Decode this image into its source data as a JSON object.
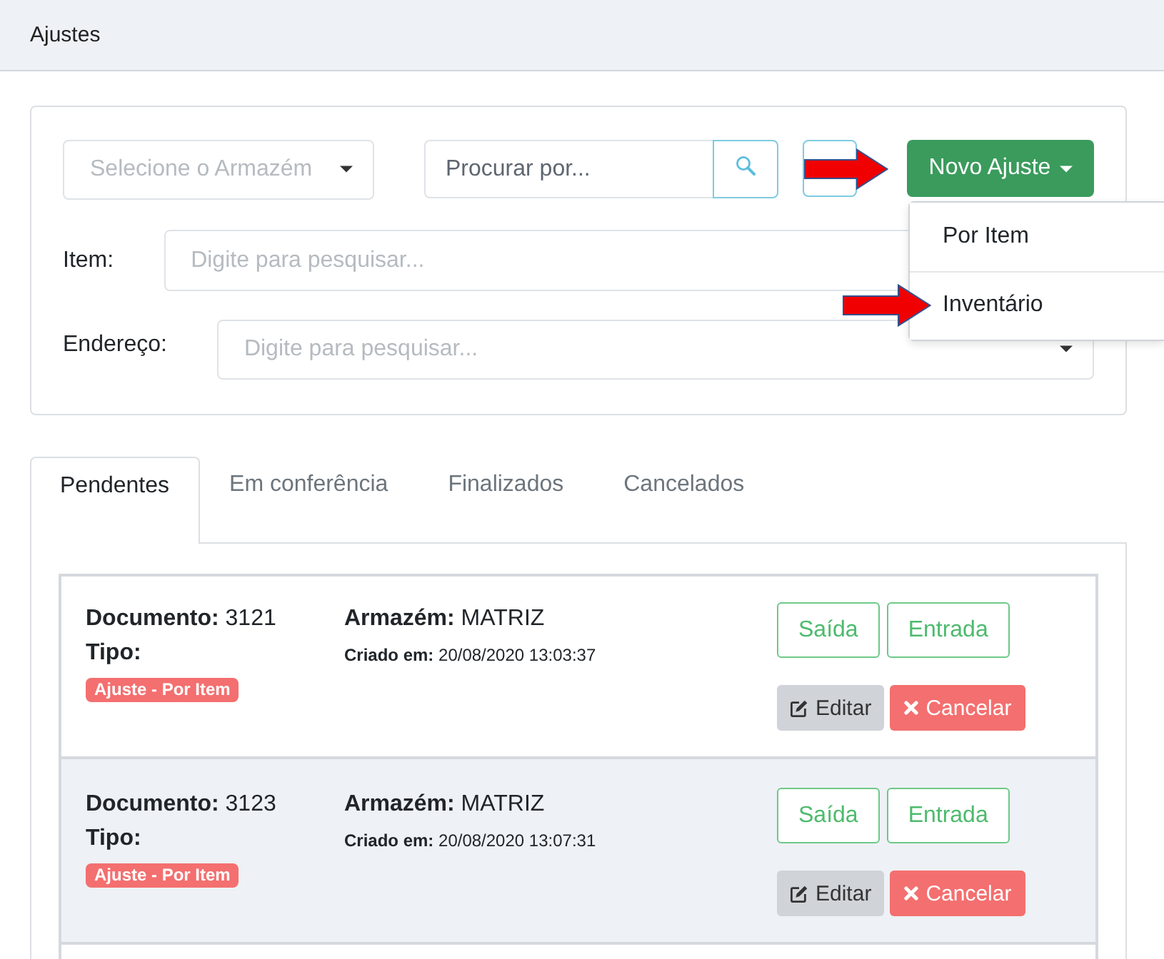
{
  "header": {
    "title": "Ajustes"
  },
  "filters": {
    "warehouse": {
      "placeholder": "Selecione o Armazém"
    },
    "search": {
      "placeholder": "Procurar por..."
    },
    "new_adjustment": {
      "label": "Novo Ajuste",
      "expanded": true,
      "menu": [
        {
          "label": "Por Item"
        },
        {
          "label": "Inventário"
        }
      ]
    },
    "item": {
      "label": "Item:",
      "placeholder": "Digite para pesquisar..."
    },
    "address": {
      "label": "Endereço:",
      "placeholder": "Digite para pesquisar..."
    }
  },
  "tabs": [
    {
      "label": "Pendentes",
      "selected": true
    },
    {
      "label": "Em conferência",
      "selected": false
    },
    {
      "label": "Finalizados",
      "selected": false
    },
    {
      "label": "Cancelados",
      "selected": false
    }
  ],
  "documents": [
    {
      "document": "**Documento:** 3121",
      "type_label": "Tipo:",
      "type": "Ajuste - Por Item",
      "warehouse": "**Armazém:** MATRIZ",
      "created": "**Criado em:** 20/08/2020 13:03:37",
      "highlighted": false,
      "actions": [
        {
          "kind": "outline",
          "label": "Saída"
        },
        {
          "kind": "outline",
          "label": "Entrada"
        },
        {
          "kind": "edit",
          "label": "Editar"
        },
        {
          "kind": "cancel",
          "label": "Cancelar"
        }
      ]
    },
    {
      "document": "**Documento:** 3123",
      "type_label": "Tipo:",
      "type": "Ajuste - Por Item",
      "warehouse": "**Armazém:** MATRIZ",
      "created": "**Criado em:** 20/08/2020 13:07:31",
      "highlighted": true,
      "actions": [
        {
          "kind": "outline",
          "label": "Saída"
        },
        {
          "kind": "outline",
          "label": "Entrada"
        },
        {
          "kind": "edit",
          "label": "Editar"
        },
        {
          "kind": "cancel",
          "label": "Cancelar"
        }
      ]
    }
  ]
}
